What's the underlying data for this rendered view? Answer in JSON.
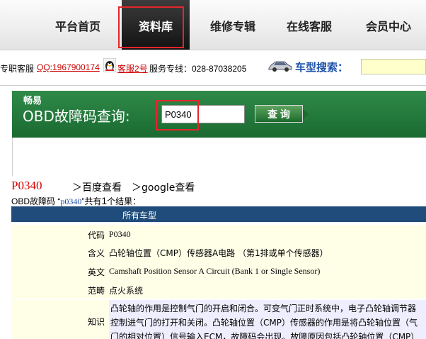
{
  "nav": {
    "items": [
      {
        "label": "平台首页",
        "active": false
      },
      {
        "label": "资料库",
        "active": true
      },
      {
        "label": "维修专辑",
        "active": false
      },
      {
        "label": "在线客服",
        "active": false
      },
      {
        "label": "会员中心",
        "active": false
      }
    ]
  },
  "contact": {
    "prefix": "专职客服",
    "qq": "QQ:1967900174",
    "kefu": "客服2号",
    "hotline": "服务专线：028-87038205",
    "search_title": "车型搜索：",
    "search_value": ""
  },
  "obd": {
    "brand": "畅易",
    "title": "OBD故障码查询:",
    "input_value": "P0340",
    "button_label": "查 询"
  },
  "result": {
    "code": "P0340",
    "baidu_link": "＞百度查看",
    "google_link": "＞google查看",
    "summary_prefix": "OBD故障码 “",
    "summary_keyword": "p0340",
    "summary_mid": "”共有",
    "summary_count": "1",
    "summary_suffix": "个结果：",
    "table_header": "所有车型",
    "rows": [
      {
        "label": "代码",
        "value": "P0340"
      },
      {
        "label": "含义",
        "value": "凸轮轴位置（CMP）传感器A电路 （第1排或单个传感器）"
      },
      {
        "label": "英文",
        "value": "Camshaft Position Sensor A Circuit (Bank 1 or Single Sensor)"
      },
      {
        "label": "范畴",
        "value": "点火系统"
      },
      {
        "label": "知识",
        "value": "凸轮轴的作用是控制气门的开启和闭合。可变气门正时系统中，电子凸轮轴调节器控制进气门的打开和关闭。凸轮轴位置（CMP）传感器的作用是将凸轮轴位置（气门的相对位置）信号输入ECM，故障码会出现。故障原因包括凸轮轴位置（CMP）传感器电路，"
      }
    ]
  },
  "colors": {
    "accent_red": "#e5252a",
    "panel_green": "#1f7a3a",
    "table_header_blue": "#1f4c7a",
    "link_blue": "#1a4fa8"
  }
}
